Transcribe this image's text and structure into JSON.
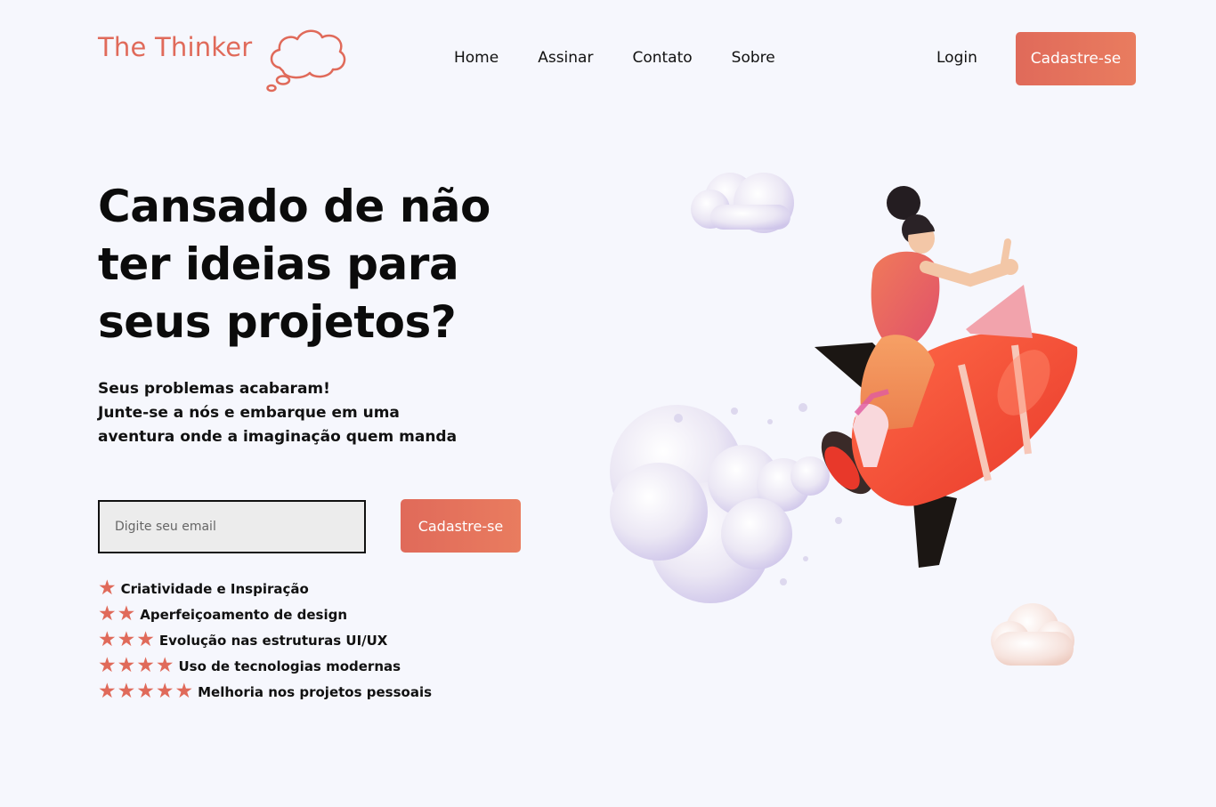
{
  "header": {
    "logo_text": "The Thinker",
    "nav": [
      {
        "label": "Home"
      },
      {
        "label": "Assinar"
      },
      {
        "label": "Contato"
      },
      {
        "label": "Sobre"
      }
    ],
    "login_label": "Login",
    "signup_label": "Cadastre-se"
  },
  "hero": {
    "title": "Cansado de não ter ideias para seus projetos?",
    "subtitle_lines": [
      "Seus problemas acabaram!",
      "Junte-se a nós e embarque em uma",
      "aventura onde a imaginação quem manda"
    ],
    "email_placeholder": "Digite seu email",
    "signup_label": "Cadastre-se"
  },
  "features": [
    {
      "label": "Criatividade e Inspiração",
      "stars": 1
    },
    {
      "label": "Aperfeiçoamento de design",
      "stars": 2
    },
    {
      "label": "Evolução nas estruturas UI/UX",
      "stars": 3
    },
    {
      "label": "Uso de tecnologias modernas",
      "stars": 4
    },
    {
      "label": "Melhoria nos projetos pessoais",
      "stars": 5
    }
  ],
  "colors": {
    "accent": "#e06a5a",
    "accent_light": "#e97c5f",
    "background": "#f6f7fd",
    "input_background": "#ececec"
  },
  "icons": {
    "logo_icon": "thought-cloud-icon",
    "feature_icon": "star-icon",
    "illustration": "girl-on-rocket-illustration"
  }
}
